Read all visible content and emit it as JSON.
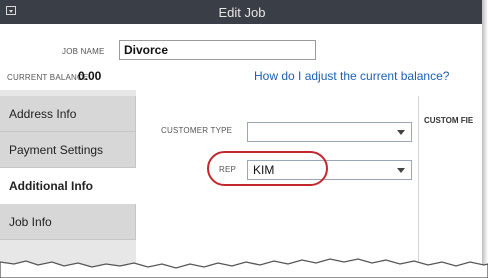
{
  "window": {
    "title": "Edit Job"
  },
  "form": {
    "job_name_label": "JOB NAME",
    "job_name_value": "Divorce",
    "current_balance_label": "CURRENT BALANCE",
    "current_balance_value": "0.00",
    "help_link": "How do I adjust the current balance?"
  },
  "tabs": [
    {
      "label": "Address Info",
      "active": false
    },
    {
      "label": "Payment Settings",
      "active": false
    },
    {
      "label": "Additional Info",
      "active": true
    },
    {
      "label": "Job Info",
      "active": false
    }
  ],
  "additional_info": {
    "customer_type_label": "CUSTOMER TYPE",
    "customer_type_value": "",
    "rep_label": "REP",
    "rep_value": "KIM",
    "custom_fields_label": "CUSTOM FIE"
  },
  "colors": {
    "titlebar": "#3a3f47",
    "link": "#1d5fb3",
    "highlight_circle": "#c2272d",
    "tab_inactive": "#d7d7d7",
    "tab_active": "#ffffff"
  }
}
